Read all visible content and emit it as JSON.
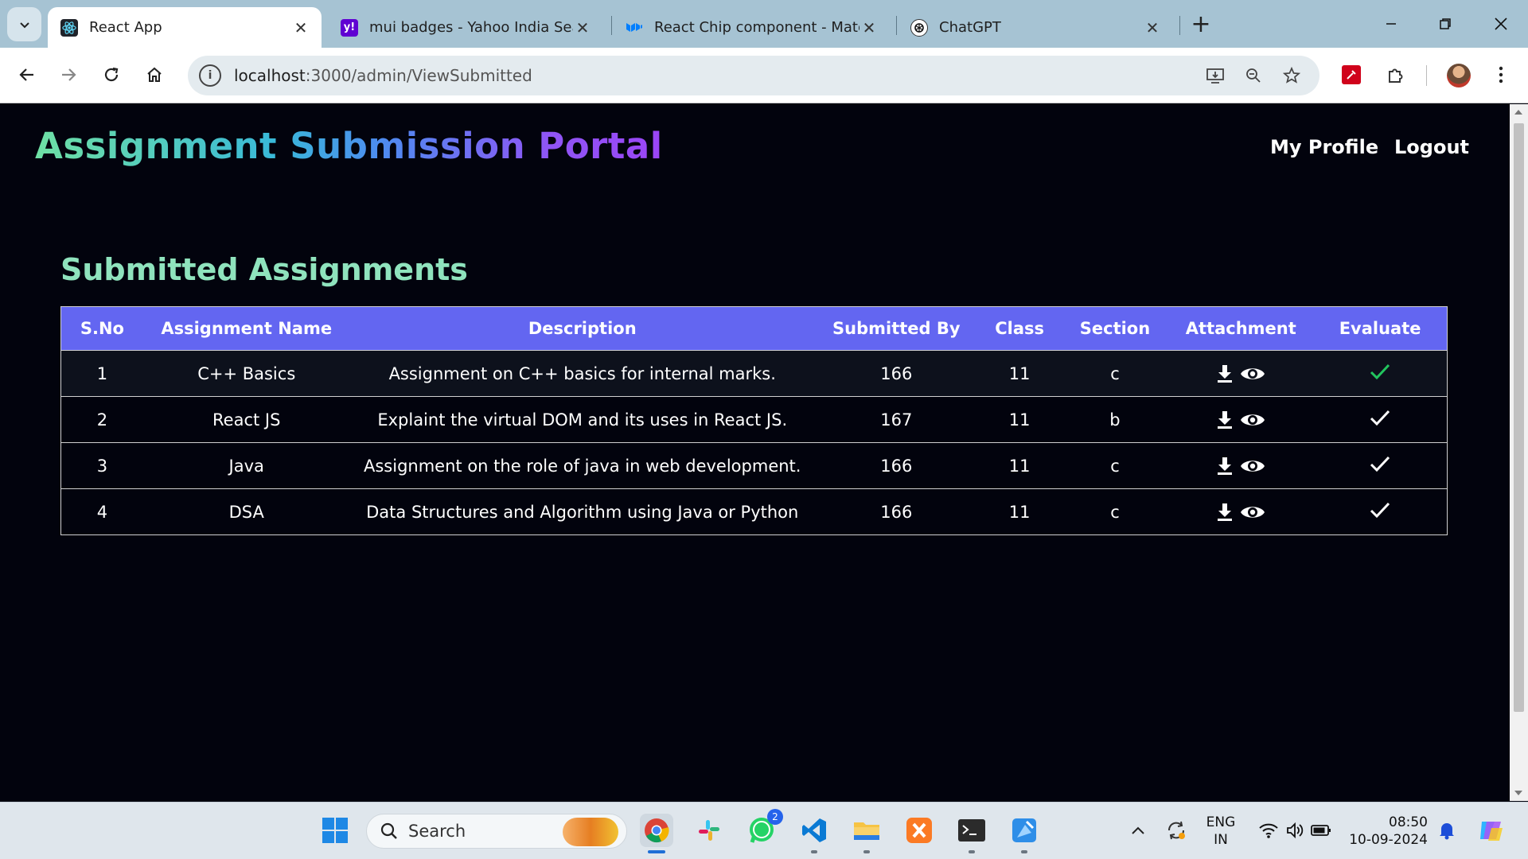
{
  "browser": {
    "tabs": [
      {
        "title": "React App",
        "icon": "react-icon",
        "active": true
      },
      {
        "title": "mui badges - Yahoo India Searc",
        "icon": "yahoo-icon",
        "active": false
      },
      {
        "title": "React Chip component - Materi",
        "icon": "mui-icon",
        "active": false
      },
      {
        "title": "ChatGPT",
        "icon": "chatgpt-icon",
        "active": false
      }
    ],
    "address": {
      "host": "localhost",
      "path": ":3000/admin/ViewSubmitted"
    }
  },
  "header": {
    "brand": "Assignment Submission Portal",
    "nav": {
      "profile": "My Profile",
      "logout": "Logout"
    }
  },
  "main": {
    "title": "Submitted Assignments",
    "columns": [
      "S.No",
      "Assignment Name",
      "Description",
      "Submitted By",
      "Class",
      "Section",
      "Attachment",
      "Evaluate"
    ],
    "rows": [
      {
        "sno": "1",
        "name": "C++ Basics",
        "description": "Assignment on C++ basics for internal marks.",
        "submitted_by": "166",
        "class": "11",
        "section": "c",
        "evaluated": true
      },
      {
        "sno": "2",
        "name": "React JS",
        "description": "Explaint the virtual DOM and its uses in React JS.",
        "submitted_by": "167",
        "class": "11",
        "section": "b",
        "evaluated": false
      },
      {
        "sno": "3",
        "name": "Java",
        "description": "Assignment on the role of java in web development.",
        "submitted_by": "166",
        "class": "11",
        "section": "c",
        "evaluated": false
      },
      {
        "sno": "4",
        "name": "DSA",
        "description": "Data Structures and Algorithm using Java or Python",
        "submitted_by": "166",
        "class": "11",
        "section": "c",
        "evaluated": false
      }
    ]
  },
  "taskbar": {
    "search_label": "Search",
    "whatsapp_badge": "2",
    "lang_top": "ENG",
    "lang_bottom": "IN",
    "time": "08:50",
    "date": "10-09-2024"
  },
  "colors": {
    "page_bg": "#02030d",
    "table_header": "#6366f1",
    "title_green": "#8fe3bd",
    "evaluated_check": "#22c55e",
    "pending_check": "#ffffff"
  }
}
